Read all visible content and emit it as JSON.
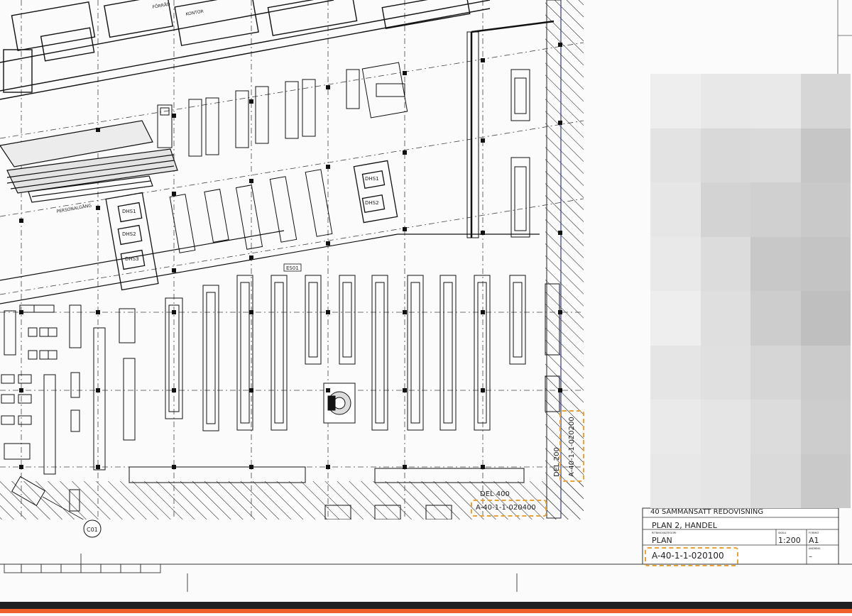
{
  "room_labels": {
    "upper_room_1": "FÖRRÅD",
    "upper_room_2": "KONTOR",
    "corridor": "PERSONALGÅNG",
    "room_a": "DHS1",
    "room_b": "DHS2",
    "room_c": "DHS3",
    "room_d": "DHS1",
    "room_e": "DHS2",
    "tag": "ES01",
    "grid_bubble": "C01"
  },
  "sections": {
    "del_400": "DEL 400",
    "del_200": "DEL 200"
  },
  "references": {
    "vertical_ref": "A-40-1-1-020200",
    "horizontal_ref": "A-40-1-1-020400"
  },
  "title_block": {
    "discipline": "40 SAMMANSATT REDOVISNING",
    "drawing_title": "PLAN 2, HANDEL",
    "drawing_type_label": "RITNINGSKATEGORI",
    "drawing_type": "PLAN",
    "scale_label": "SKALA",
    "scale": "1:200",
    "format_label": "FORMAT",
    "format": "A1",
    "revision_label": "ÄNDRING",
    "revision": "–",
    "drawing_number": "A-40-1-1-020100"
  },
  "colors": {
    "line": "#1a1a1a",
    "highlight": "#e8a23a",
    "accent_bar": "#f0602a",
    "dark_bar": "#1f1f22"
  },
  "redacted_block": [
    "#eeeeee",
    "#e8e8e8",
    "#e9e9e9",
    "#d6d6d6",
    "#e3e3e3",
    "#d9d9d9",
    "#dadada",
    "#c6c6c6",
    "#e6e6e6",
    "#d3d3d3",
    "#d0d0d0",
    "#c9c9c9",
    "#e9e9e9",
    "#dcdcdc",
    "#c8c8c8",
    "#c4c4c4",
    "#eeeeee",
    "#dfdfdf",
    "#cdcdcd",
    "#bfbfbf",
    "#e5e5e5",
    "#e0e0e0",
    "#d6d6d6",
    "#cbcbcb",
    "#eaeaea",
    "#e5e5e5",
    "#dcdcdc",
    "#cdcdcd",
    "#e8e8e8",
    "#e5e5e5",
    "#dadada",
    "#c9c9c9"
  ]
}
